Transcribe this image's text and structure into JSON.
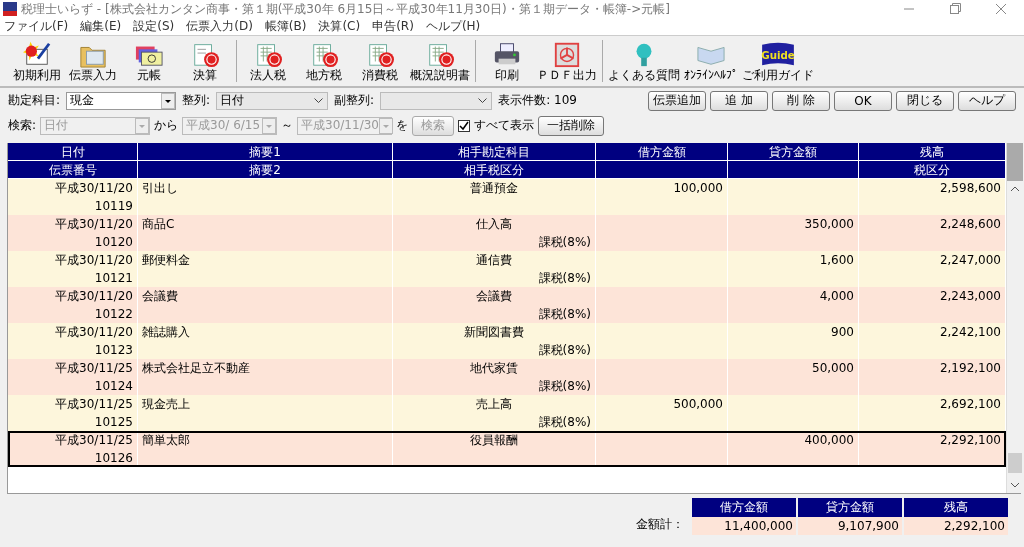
{
  "window": {
    "title": "税理士いらず - [株式会社カンタン商事・第１期(平成30年 6月15日～平成30年11月30日)・第１期データ・帳簿->元帳]"
  },
  "menu": [
    "ファイル(F)",
    "編集(E)",
    "設定(S)",
    "伝票入力(D)",
    "帳簿(B)",
    "決算(C)",
    "申告(R)",
    "ヘルプ(H)"
  ],
  "toolbar": {
    "groups": [
      [
        {
          "label": "初期利用"
        },
        {
          "label": "伝票入力"
        },
        {
          "label": "元帳"
        },
        {
          "label": "決算"
        }
      ],
      [
        {
          "label": "法人税"
        },
        {
          "label": "地方税"
        },
        {
          "label": "消費税"
        },
        {
          "label": "概況説明書"
        }
      ],
      [
        {
          "label": "印刷"
        },
        {
          "label": "ＰＤＦ出力"
        }
      ],
      [
        {
          "label": "よくある質問"
        },
        {
          "label": "ｵﾝﾗｲﾝﾍﾙﾌﾟ"
        },
        {
          "label": "ご利用ガイド",
          "stamp": "Guide"
        }
      ]
    ]
  },
  "filter_rows": [
    [
      {
        "kind": "label",
        "text": "勘定科目:"
      },
      {
        "kind": "entry_combo",
        "value": "現金",
        "disabled": false
      },
      {
        "kind": "label",
        "text": "整列:"
      },
      {
        "kind": "list_combo",
        "value": "日付",
        "disabled": false
      },
      {
        "kind": "label",
        "text": "副整列:"
      },
      {
        "kind": "list_combo",
        "disabled": false
      },
      {
        "kind": "label",
        "text": "表示件数: 109"
      }
    ],
    [
      {
        "kind": "label",
        "text": "検索:"
      },
      {
        "kind": "entry_combo",
        "value": "日付",
        "disabled": true
      },
      {
        "kind": "label",
        "text": "から"
      },
      {
        "kind": "entry_combo",
        "value": "平成30/ 6/15",
        "disabled": true
      },
      {
        "kind": "label",
        "text": "～"
      },
      {
        "kind": "entry_combo",
        "value": "平成30/11/30",
        "disabled": true
      },
      {
        "kind": "label",
        "text": "を"
      },
      {
        "kind": "button",
        "text": "検索",
        "disabled": true
      },
      {
        "kind": "checkbox",
        "text": "すべて表示",
        "checked": true
      },
      {
        "kind": "button",
        "text": "一括削除",
        "disabled": false
      }
    ]
  ],
  "action_buttons": [
    "伝票追加",
    "追 加",
    "削 除",
    "OK",
    "閉じる",
    "ヘルプ"
  ],
  "table": {
    "columns": [
      {
        "top": "日付",
        "bottom": "伝票番号"
      },
      {
        "top": "摘要1",
        "bottom": "摘要2"
      },
      {
        "top": "相手勘定科目",
        "bottom": "相手税区分"
      },
      {
        "top": "借方金額"
      },
      {
        "top": "貸方金額"
      },
      {
        "top": "残高",
        "bottom": "税区分"
      }
    ],
    "rows": [
      {
        "date": "平成30/11/20",
        "summary": "引出し",
        "account": "普通預金",
        "debit": "100,000",
        "balance": "2,598,600",
        "voucher": "10119",
        "selected": false
      },
      {
        "date": "平成30/11/20",
        "summary": "商品C",
        "account": "仕入高",
        "credit": "350,000",
        "balance": "2,248,600",
        "voucher": "10120",
        "partner_tax": "課税(8%)",
        "selected": false
      },
      {
        "date": "平成30/11/20",
        "summary": "郵便料金",
        "account": "通信費",
        "credit": "1,600",
        "balance": "2,247,000",
        "voucher": "10121",
        "partner_tax": "課税(8%)",
        "selected": false
      },
      {
        "date": "平成30/11/20",
        "summary": "会議費",
        "account": "会議費",
        "credit": "4,000",
        "balance": "2,243,000",
        "voucher": "10122",
        "partner_tax": "課税(8%)",
        "selected": false
      },
      {
        "date": "平成30/11/20",
        "summary": "雑誌購入",
        "account": "新聞図書費",
        "credit": "900",
        "balance": "2,242,100",
        "voucher": "10123",
        "partner_tax": "課税(8%)",
        "selected": false
      },
      {
        "date": "平成30/11/25",
        "summary": "株式会社足立不動産",
        "account": "地代家賃",
        "credit": "50,000",
        "balance": "2,192,100",
        "voucher": "10124",
        "partner_tax": "課税(8%)",
        "selected": false
      },
      {
        "date": "平成30/11/25",
        "summary": "現金売上",
        "account": "売上高",
        "debit": "500,000",
        "balance": "2,692,100",
        "voucher": "10125",
        "partner_tax": "課税(8%)",
        "selected": false
      },
      {
        "date": "平成30/11/25",
        "summary": "簡単太郎",
        "account": "役員報酬",
        "credit": "400,000",
        "balance": "2,292,100",
        "voucher": "10126",
        "selected": true
      }
    ]
  },
  "totals": {
    "label": "金額計：",
    "columns": [
      "借方金額",
      "貸方金額",
      "残高"
    ],
    "values": [
      "11,400,000",
      "9,107,900",
      "2,292,100"
    ]
  }
}
